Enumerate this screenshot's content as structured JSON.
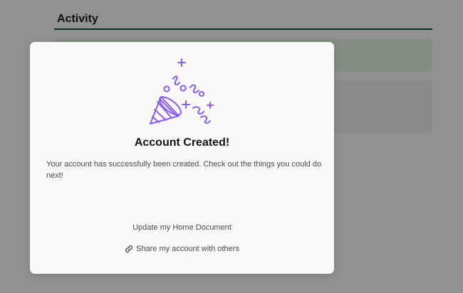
{
  "background": {
    "section_title": "Activity"
  },
  "modal": {
    "icon": "party-popper-icon",
    "title": "Account Created!",
    "body": "Your account has successfully been created. Check out the things you could do next!",
    "actions": {
      "home_document": "Update my Home Document",
      "share_account": "Share my account with others",
      "share_icon": "link-icon"
    }
  },
  "colors": {
    "accent": "#8b5cf6",
    "overlay": "#000000",
    "activity_rule": "#1f4d36"
  }
}
